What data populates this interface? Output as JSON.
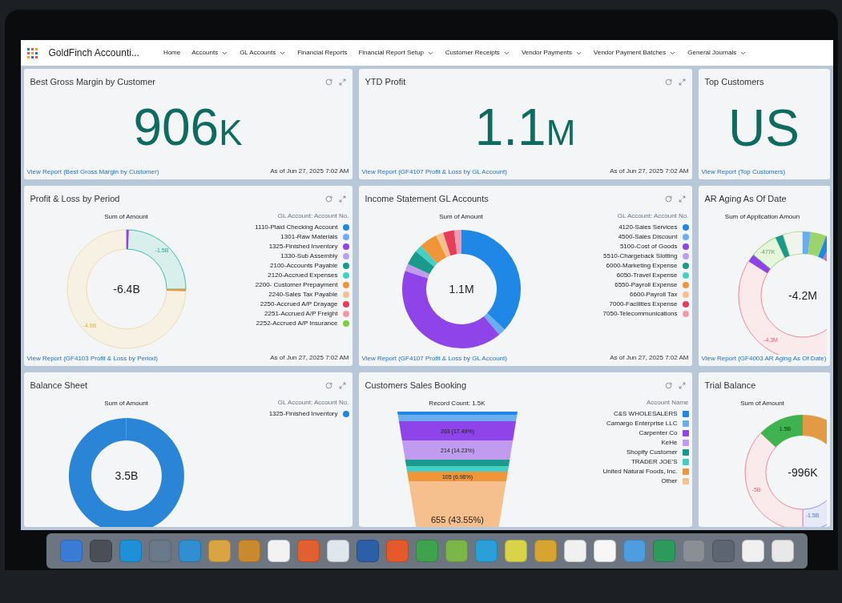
{
  "app_title": "GoldFinch Accounti...",
  "nav": [
    {
      "label": "Home",
      "has_menu": false
    },
    {
      "label": "Accounts",
      "has_menu": true
    },
    {
      "label": "GL Accounts",
      "has_menu": true
    },
    {
      "label": "Financial Reports",
      "has_menu": false
    },
    {
      "label": "Financial Report Setup",
      "has_menu": true
    },
    {
      "label": "Customer Receipts",
      "has_menu": true
    },
    {
      "label": "Vendor Payments",
      "has_menu": true
    },
    {
      "label": "Vendor Payment Batches",
      "has_menu": true
    },
    {
      "label": "General Journals",
      "has_menu": true
    }
  ],
  "cards": [
    {
      "kind": "metric",
      "title": "Best Gross Margin by Customer",
      "tools": true,
      "value": "906",
      "unit": "K",
      "link": "View Report (Best Gross Margin by Customer)",
      "as_of": "As of Jun 27, 2025 7:02 AM"
    },
    {
      "kind": "metric",
      "title": "YTD Profit",
      "tools": true,
      "value": "1.1",
      "unit": "M",
      "link": "View Report (GF4107 Profit & Loss by GL Account)",
      "as_of": "As of Jun 27, 2025 7:02 AM"
    },
    {
      "kind": "metric",
      "title": "Top Customers",
      "tools": false,
      "value": "US",
      "link": "View Report (Top Customers)"
    },
    {
      "kind": "donut",
      "title": "Profit & Loss by Period",
      "tools": true,
      "chart_title": "Sum of Amount",
      "center": "-6.4B",
      "data_labels": [
        "-1.5B",
        "-4.9B"
      ],
      "legend_title": "GL Account: Account No.",
      "legend": [
        {
          "label": "1110-Plaid Checking Account",
          "color": "#1f87e5"
        },
        {
          "label": "1301-Raw Materials",
          "color": "#6aaef0"
        },
        {
          "label": "1325-Finished Inventory",
          "color": "#8e44e8"
        },
        {
          "label": "1330-Sub Assembly",
          "color": "#c19bf0"
        },
        {
          "label": "2100-Accounts Payable",
          "color": "#1a9a8a"
        },
        {
          "label": "2120-Accrued Expenses",
          "color": "#44cfc4"
        },
        {
          "label": "2200- Customer Prepayment",
          "color": "#f0953a"
        },
        {
          "label": "2240-Sales Tax Payable",
          "color": "#f5c08e"
        },
        {
          "label": "2250-Accrued A/P Drayage",
          "color": "#e83c5c"
        },
        {
          "label": "2251-Accrued A/P Freight",
          "color": "#f29aab"
        },
        {
          "label": "2252-Accrued A/P Insurance",
          "color": "#7ccf3c"
        }
      ],
      "link": "View Report (GF4103 Profit & Loss by Period)",
      "as_of": "As of Jun 27, 2025 7:02 AM"
    },
    {
      "kind": "donut",
      "title": "Income Statement GL Accounts",
      "tools": true,
      "chart_title": "Sum of Amount",
      "center": "1.1M",
      "legend_title": "GL Account: Account No.",
      "legend": [
        {
          "label": "4120-Sales Services",
          "color": "#1f87e5"
        },
        {
          "label": "4500-Sales Discount",
          "color": "#6aaef0"
        },
        {
          "label": "5100-Cost of Goods",
          "color": "#8e44e8"
        },
        {
          "label": "5510-Chargeback Slotting",
          "color": "#c19bf0"
        },
        {
          "label": "6000-Marketing Expense",
          "color": "#1a9a8a"
        },
        {
          "label": "6050-Travel Expense",
          "color": "#44cfc4"
        },
        {
          "label": "6550-Payroll Expense",
          "color": "#f0953a"
        },
        {
          "label": "6600-Payroll Tax",
          "color": "#f5c08e"
        },
        {
          "label": "7000-Facilities Expense",
          "color": "#e83c5c"
        },
        {
          "label": "7050-Telecommunications",
          "color": "#f29aab"
        }
      ],
      "link": "View Report (GF4107 Profit & Loss by GL Account)",
      "as_of": "As of Jun 27, 2025 7:02 AM"
    },
    {
      "kind": "donut",
      "title": "AR Aging As Of Date",
      "tools": false,
      "chart_title": "Sum of Application Amoun",
      "center": "-4.2M",
      "data_labels": [
        "-477K",
        "-4.3M"
      ],
      "link": "View Report (GF4003 AR Aging As Of Date)"
    },
    {
      "kind": "donut",
      "title": "Balance Sheet",
      "tools": true,
      "chart_title": "Sum of Amount",
      "center": "3.5B",
      "legend_title": "GL Account: Account No.",
      "legend": [
        {
          "label": "1325-Finished Inventory",
          "color": "#1f87e5"
        }
      ]
    },
    {
      "kind": "funnel",
      "title": "Customers Sales Booking",
      "tools": true,
      "chart_title": "Record Count: 1.5K",
      "legend_title": "Account Name",
      "legend": [
        {
          "label": "C&S WHOLESALERS",
          "color": "#1f87e5"
        },
        {
          "label": "Camargo Enterprise LLC",
          "color": "#6aaef0"
        },
        {
          "label": "Carpenter Co",
          "color": "#8e44e8",
          "data_label": "263 (17.49%)"
        },
        {
          "label": "KeHe",
          "color": "#c19bf0",
          "data_label": "214 (14.23%)"
        },
        {
          "label": "Shopify Customer",
          "color": "#1a9a8a"
        },
        {
          "label": "TRADER JOE'S",
          "color": "#44cfc4"
        },
        {
          "label": "United Natural Foods, Inc.",
          "color": "#f0953a",
          "data_label": "105 (6.98%)"
        },
        {
          "label": "Other",
          "color": "#f5c08e",
          "data_label": "655 (43.55%)"
        }
      ]
    },
    {
      "kind": "donut",
      "title": "Trial Balance",
      "tools": false,
      "chart_title": "Sum of Amount",
      "center": "-996K",
      "data_labels": [
        "1.5B",
        "-5B",
        "-1.5B"
      ]
    }
  ]
}
